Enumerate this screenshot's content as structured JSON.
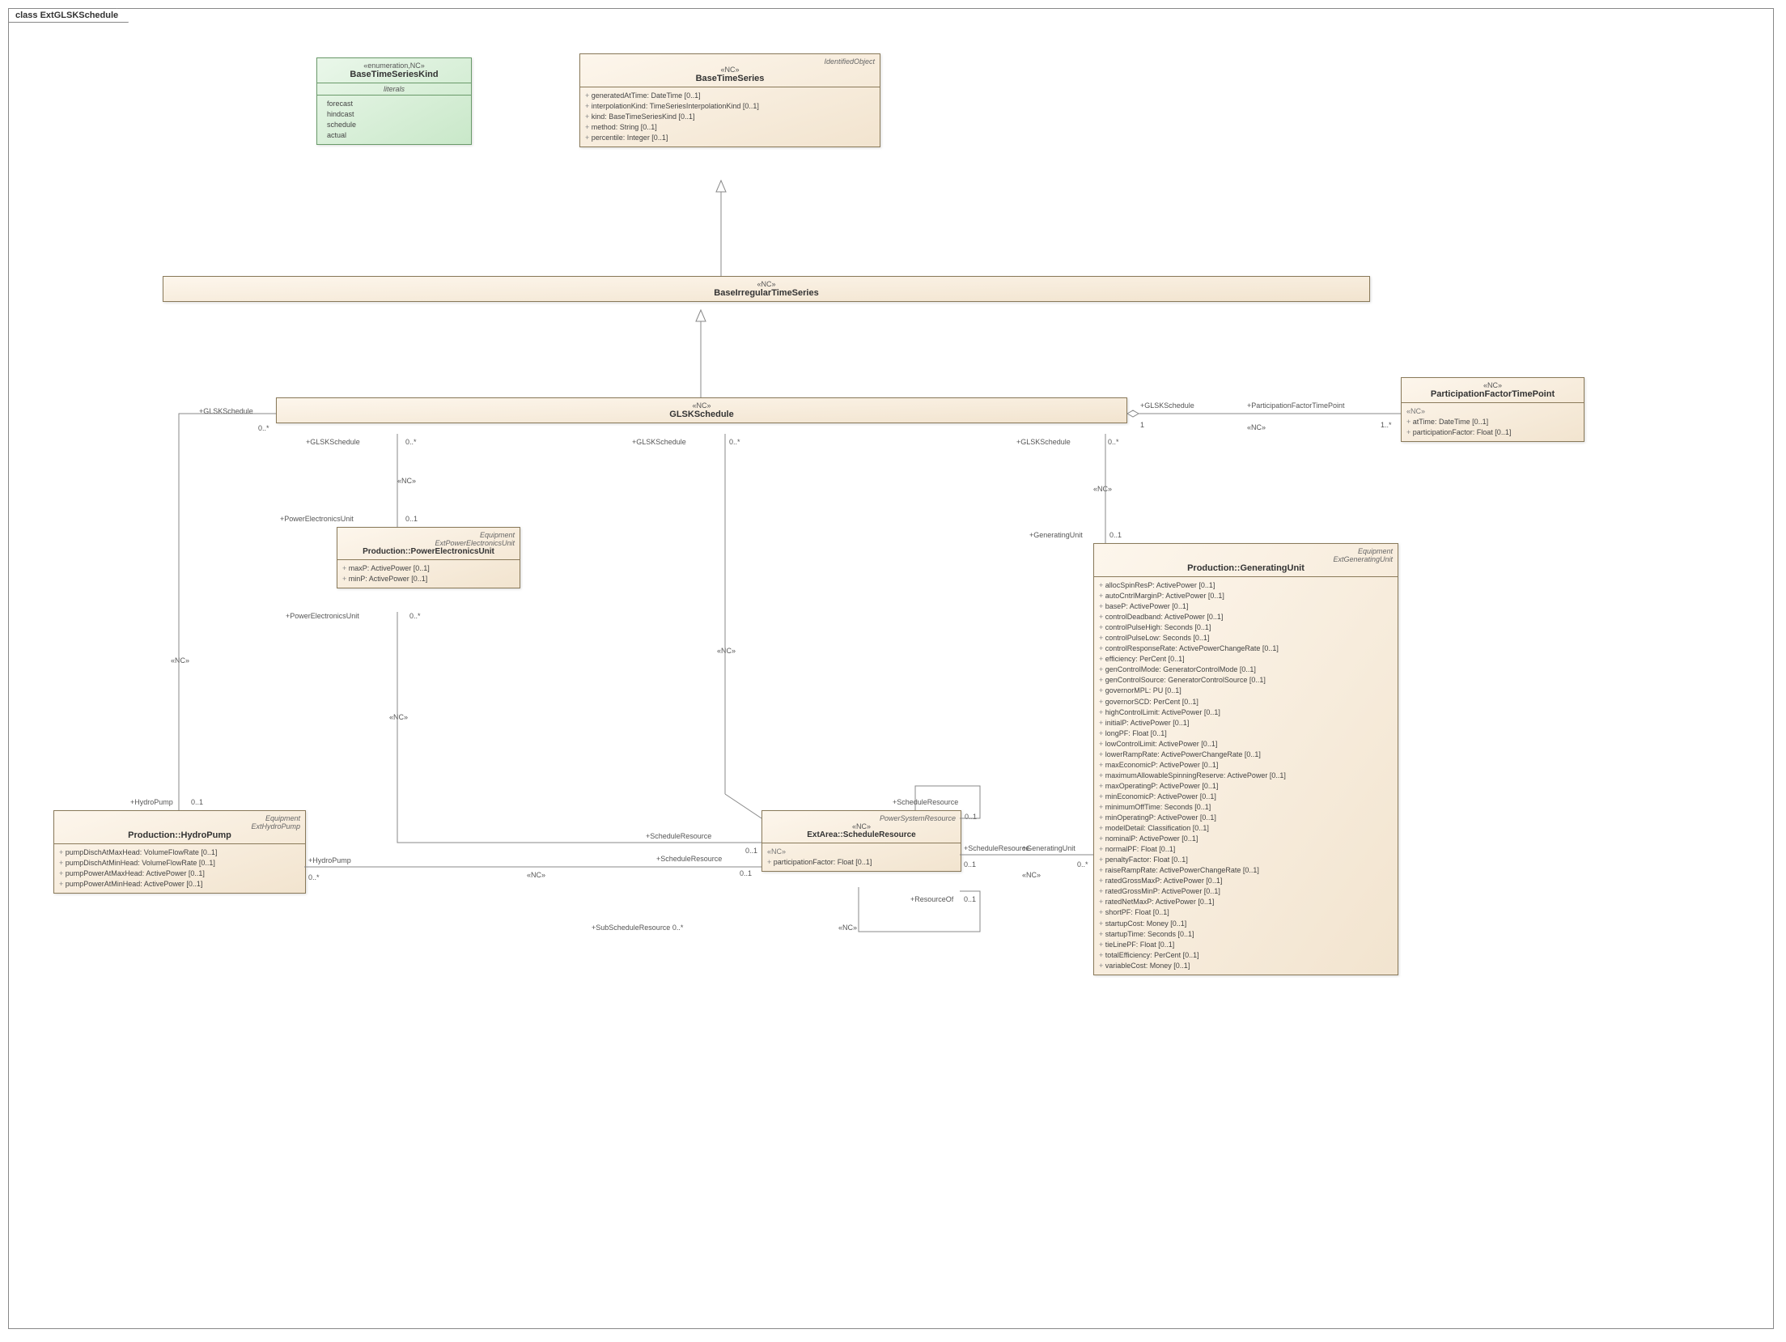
{
  "diagram": {
    "title": "class ExtGLSKSchedule"
  },
  "enumBaseTimeSeriesKind": {
    "stereo": "«enumeration,NC»",
    "name": "BaseTimeSeriesKind",
    "sectionLabel": "literals",
    "literals": [
      "forecast",
      "hindcast",
      "schedule",
      "actual"
    ]
  },
  "baseTimeSeries": {
    "parent": "IdentifiedObject",
    "stereo": "«NC»",
    "name": "BaseTimeSeries",
    "attrs": [
      "generatedAtTime: DateTime [0..1]",
      "interpolationKind: TimeSeriesInterpolationKind [0..1]",
      "kind: BaseTimeSeriesKind [0..1]",
      "method: String [0..1]",
      "percentile: Integer [0..1]"
    ]
  },
  "baseIrregularTimeSeries": {
    "stereo": "«NC»",
    "name": "BaseIrregularTimeSeries"
  },
  "glskSchedule": {
    "stereo": "«NC»",
    "name": "GLSKSchedule"
  },
  "participationFactorTimePoint": {
    "stereo": "«NC»",
    "name": "ParticipationFactorTimePoint",
    "attrs": [
      "atTime: DateTime [0..1]",
      "participationFactor: Float [0..1]"
    ]
  },
  "powerElectronicsUnit": {
    "parent": "Equipment",
    "tag": "ExtPowerElectronicsUnit",
    "name": "Production::PowerElectronicsUnit",
    "attrs": [
      "maxP: ActivePower [0..1]",
      "minP: ActivePower [0..1]"
    ]
  },
  "hydroPump": {
    "parent": "Equipment",
    "tag": "ExtHydroPump",
    "name": "Production::HydroPump",
    "attrs": [
      "pumpDischAtMaxHead: VolumeFlowRate [0..1]",
      "pumpDischAtMinHead: VolumeFlowRate [0..1]",
      "pumpPowerAtMaxHead: ActivePower [0..1]",
      "pumpPowerAtMinHead: ActivePower [0..1]"
    ]
  },
  "scheduleResource": {
    "parent": "PowerSystemResource",
    "stereo": "«NC»",
    "name": "ExtArea::ScheduleResource",
    "subStereo": "«NC»",
    "attrs": [
      "participationFactor: Float [0..1]"
    ]
  },
  "generatingUnit": {
    "parent": "Equipment",
    "tag": "ExtGeneratingUnit",
    "name": "Production::GeneratingUnit",
    "attrs": [
      "allocSpinResP: ActivePower [0..1]",
      "autoCntrlMarginP: ActivePower [0..1]",
      "baseP: ActivePower [0..1]",
      "controlDeadband: ActivePower [0..1]",
      "controlPulseHigh: Seconds [0..1]",
      "controlPulseLow: Seconds [0..1]",
      "controlResponseRate: ActivePowerChangeRate [0..1]",
      "efficiency: PerCent [0..1]",
      "genControlMode: GeneratorControlMode [0..1]",
      "genControlSource: GeneratorControlSource [0..1]",
      "governorMPL: PU [0..1]",
      "governorSCD: PerCent [0..1]",
      "highControlLimit: ActivePower [0..1]",
      "initialP: ActivePower [0..1]",
      "longPF: Float [0..1]",
      "lowControlLimit: ActivePower [0..1]",
      "lowerRampRate: ActivePowerChangeRate [0..1]",
      "maxEconomicP: ActivePower [0..1]",
      "maximumAllowableSpinningReserve: ActivePower [0..1]",
      "maxOperatingP: ActivePower [0..1]",
      "minEconomicP: ActivePower [0..1]",
      "minimumOffTime: Seconds [0..1]",
      "minOperatingP: ActivePower [0..1]",
      "modelDetail: Classification [0..1]",
      "nominalP: ActivePower [0..1]",
      "normalPF: Float [0..1]",
      "penaltyFactor: Float [0..1]",
      "raiseRampRate: ActivePowerChangeRate [0..1]",
      "ratedGrossMaxP: ActivePower [0..1]",
      "ratedGrossMinP: ActivePower [0..1]",
      "ratedNetMaxP: ActivePower [0..1]",
      "shortPF: Float [0..1]",
      "startupCost: Money [0..1]",
      "startupTime: Seconds [0..1]",
      "tieLinePF: Float [0..1]",
      "totalEfficiency: PerCent [0..1]",
      "variableCost: Money [0..1]"
    ]
  },
  "labels": {
    "nc": "«NC»",
    "glskSchedule": "+GLSKSchedule",
    "glskScheduleM0": "0..*",
    "glskScheduleM1": "1",
    "participationFactorTimePoint": "+ParticipationFactorTimePoint",
    "pftpMult": "1..*",
    "powerElectronicsUnit": "+PowerElectronicsUnit",
    "peuMult": "0..1",
    "peuMult2": "0..*",
    "generatingUnit": "+GeneratingUnit",
    "genMult": "0..1",
    "hydroPump": "+HydroPump",
    "hpMult": "0..1",
    "hpMult2": "0..*",
    "scheduleResource": "+ScheduleResource",
    "srMult01": "0..1",
    "srMult0s": "0..*",
    "resourceOf": "+ResourceOf",
    "subScheduleResource": "+SubScheduleResource 0..*"
  }
}
